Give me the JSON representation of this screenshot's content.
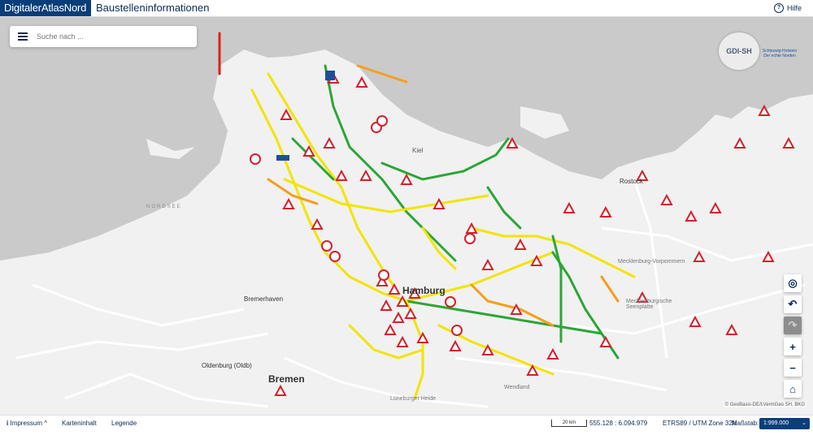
{
  "header": {
    "brand": "DigitalerAtlasNord",
    "title": "Baustelleninformationen",
    "help_label": "Hilfe"
  },
  "search": {
    "placeholder": "Suche nach ..."
  },
  "logo": {
    "text": "GDI-SH",
    "partner_line1": "Schleswig-Holstein",
    "partner_line2": "Der echte Norden"
  },
  "map_labels": {
    "nordsee": "NORDSEE",
    "kiel": "Kiel",
    "hamburg": "Hamburg",
    "rostock": "Rostock",
    "bremen": "Bremen",
    "bremerhaven": "Bremerhaven",
    "oldenburg": "Oldenburg (Oldb)",
    "mecklenburg": "Mecklenburgische Seenplatte",
    "mecklenburg_vorpommern": "Mecklenburg-Vorpommern",
    "lueneburger_heide": "Lüneburger Heide",
    "wendland": "Wendland"
  },
  "map_controls": {
    "locate": "◎",
    "undo": "↶",
    "redo": "↷",
    "zoom_in": "+",
    "zoom_out": "−",
    "home": "⌂"
  },
  "attribution": "© GeoBasis-DE/LVermGeo SH, BKG",
  "footer": {
    "impressum": "Impressum",
    "karteninhalt": "Karteninhalt",
    "legende": "Legende",
    "scale_bar": "20 km",
    "coordinates": "555.128 : 6.094.979",
    "crs": "ETRS89 / UTM Zone 32N",
    "massstab_label": "Maßstab:",
    "massstab_value": "1:999.000"
  },
  "colors": {
    "brand": "#0a3e7a",
    "road_green": "#2ba636",
    "road_yellow": "#f2e400",
    "road_orange": "#f59e1b",
    "road_red": "#e02020",
    "warning_red": "#d4202a"
  }
}
